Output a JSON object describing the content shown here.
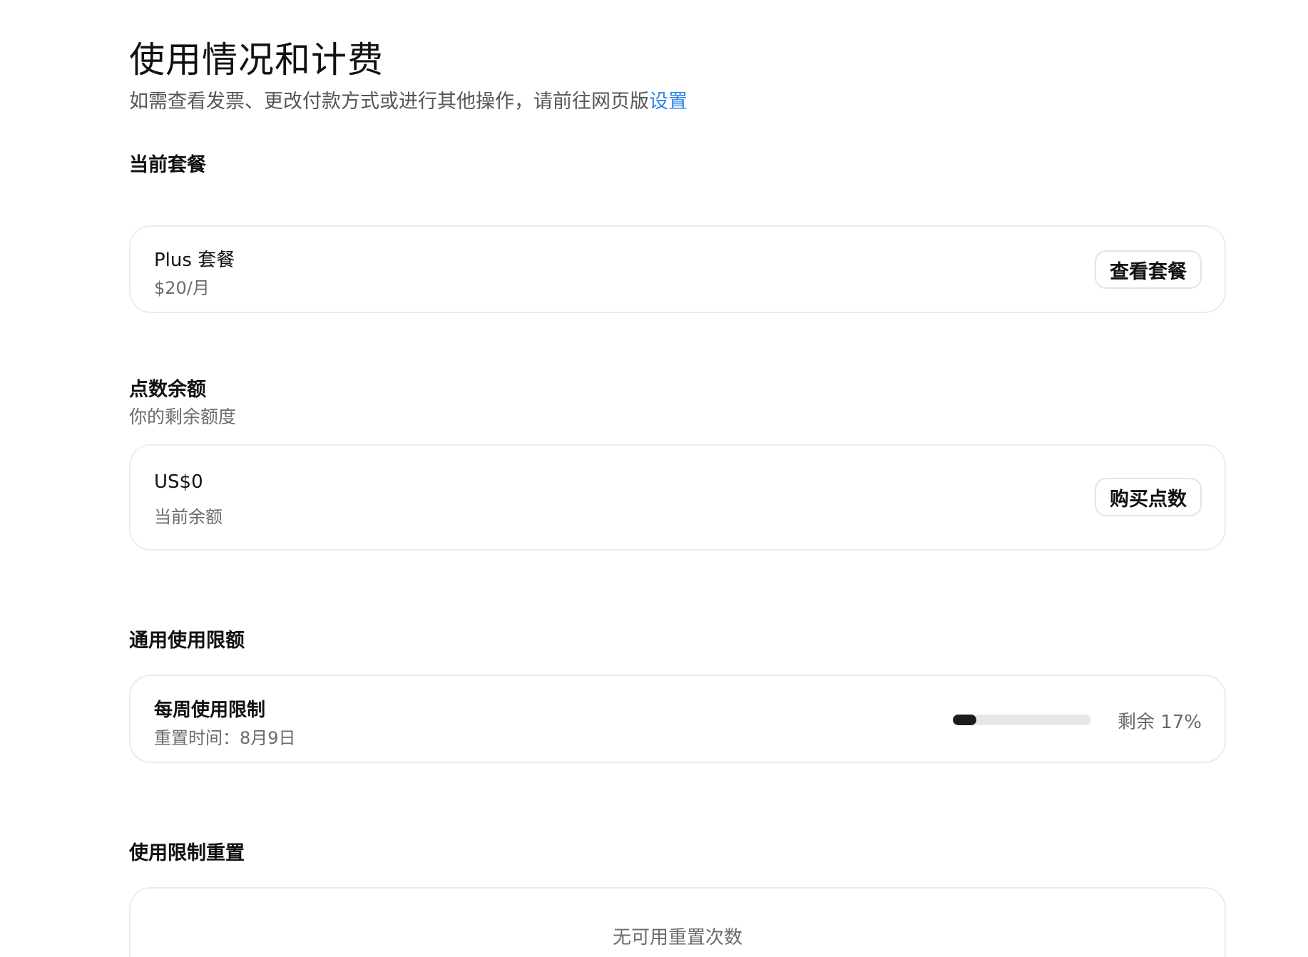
{
  "header": {
    "title": "使用情况和计费",
    "subtitle_prefix": "如需查看发票、更改付款方式或进行其他操作，请前往网页版",
    "subtitle_link": "设置"
  },
  "current_plan": {
    "heading": "当前套餐",
    "plan_name": "Plus 套餐",
    "price": "$20/月",
    "button_label": "查看套餐"
  },
  "credit_balance": {
    "heading": "点数余额",
    "subheading": "你的剩余额度",
    "amount": "US$0",
    "amount_label": "当前余额",
    "button_label": "购买点数"
  },
  "usage_limits": {
    "heading": "通用使用限额",
    "limit_name": "每周使用限制",
    "reset_time": "重置时间：8月9日",
    "remaining_percent": 17,
    "remaining_label": "剩余 17%"
  },
  "limit_reset": {
    "heading": "使用限制重置",
    "empty_text": "无可用重置次数"
  },
  "colors": {
    "link": "#2f86e8",
    "progress_fill": "#1c1c1c",
    "progress_track": "#e7e7e7"
  }
}
